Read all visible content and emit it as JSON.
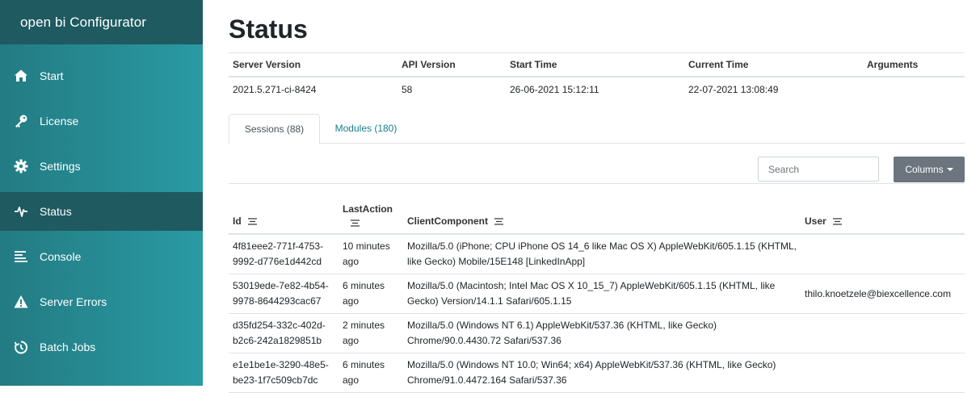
{
  "app": {
    "title": "open bi Configurator"
  },
  "sidebar": {
    "items": [
      {
        "label": "Start",
        "icon": "home-icon"
      },
      {
        "label": "License",
        "icon": "key-icon"
      },
      {
        "label": "Settings",
        "icon": "gear-icon"
      },
      {
        "label": "Status",
        "icon": "pulse-icon",
        "active": true
      },
      {
        "label": "Console",
        "icon": "console-icon"
      },
      {
        "label": "Server Errors",
        "icon": "warning-icon"
      },
      {
        "label": "Batch Jobs",
        "icon": "timer-icon"
      }
    ]
  },
  "page": {
    "title": "Status"
  },
  "server_info": {
    "headers": [
      "Server Version",
      "API Version",
      "Start Time",
      "Current Time",
      "Arguments"
    ],
    "values": [
      "2021.5.271-ci-8424",
      "58",
      "26-06-2021 15:12:11",
      "22-07-2021 13:08:49",
      ""
    ]
  },
  "tabs": [
    {
      "label": "Sessions (88)",
      "active": true
    },
    {
      "label": "Modules (180)",
      "active": false
    }
  ],
  "toolbar": {
    "search_placeholder": "Search",
    "columns_label": "Columns"
  },
  "sessions": {
    "headers": [
      "Id",
      "LastAction",
      "ClientComponent",
      "User"
    ],
    "rows": [
      [
        "4f81eee2-771f-4753-9992-d776e1d442cd",
        "10 minutes ago",
        "Mozilla/5.0 (iPhone; CPU iPhone OS 14_6 like Mac OS X) AppleWebKit/605.1.15 (KHTML, like Gecko) Mobile/15E148 [LinkedInApp]",
        ""
      ],
      [
        "53019ede-7e82-4b54-9978-8644293cac67",
        "6 minutes ago",
        "Mozilla/5.0 (Macintosh; Intel Mac OS X 10_15_7) AppleWebKit/605.1.15 (KHTML, like Gecko) Version/14.1.1 Safari/605.1.15",
        "thilo.knoetzele@biexcellence.com"
      ],
      [
        "d35fd254-332c-402d-b2c6-242a1829851b",
        "2 minutes ago",
        "Mozilla/5.0 (Windows NT 6.1) AppleWebKit/537.36 (KHTML, like Gecko) Chrome/90.0.4430.72 Safari/537.36",
        ""
      ],
      [
        "e1e1be1e-3290-48e5-be23-1f7c509cb7dc",
        "6 minutes ago",
        "Mozilla/5.0 (Windows NT 10.0; Win64; x64) AppleWebKit/537.36 (KHTML, like Gecko) Chrome/91.0.4472.164 Safari/537.36",
        ""
      ]
    ]
  },
  "colors": {
    "sidebar_dark": "#1e5a60",
    "sidebar_gradient_start": "#237b83",
    "sidebar_gradient_end": "#2a9aa3",
    "link": "#17808a",
    "button_gray": "#6c757d"
  }
}
